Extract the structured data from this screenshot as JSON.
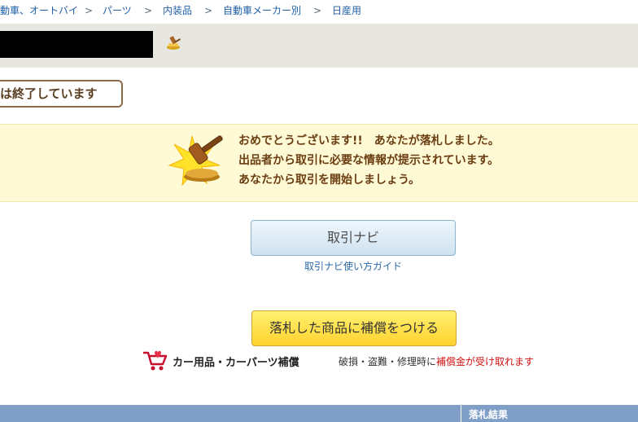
{
  "breadcrumb": {
    "items": [
      "動車、オートバイ",
      "パーツ",
      "内装品",
      "自動車メーカー別",
      "日産用"
    ],
    "separator": ">"
  },
  "title_bar": {
    "icon": "auction-gavel-icon"
  },
  "status": {
    "ended_label": "は終了しています"
  },
  "congrats": {
    "line1": "おめでとうございます!!　あなたが落札しました。",
    "line2": "出品者から取引に必要な情報が提示されています。",
    "line3": "あなたから取引を開始しましょう。",
    "icon": "gavel-icon"
  },
  "navi": {
    "button_label": "取引ナビ",
    "guide_link": "取引ナビ使い方ガイド"
  },
  "compensation": {
    "button_label": "落札した商品に補償をつける",
    "car_title": "カー用品・カーパーツ補償",
    "desc_prefix": "破損・盗難・修理時に",
    "desc_highlight": "補償金が受け取れます"
  },
  "result_header": {
    "label": "落札結果"
  },
  "colors": {
    "link": "#1f5fa6",
    "congrats_bg": "#fffad6",
    "congrats_text": "#6b3e12",
    "highlight_red": "#d01010",
    "bottom_bar": "#7f9fc8"
  }
}
